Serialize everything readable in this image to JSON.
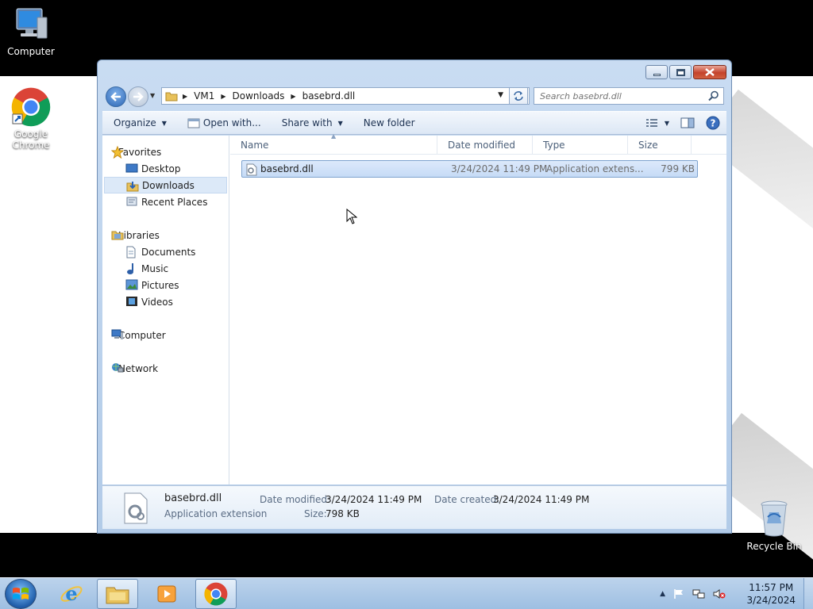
{
  "desktop": {
    "icons": [
      {
        "label": "Computer"
      },
      {
        "label": "Google Chrome"
      },
      {
        "label": "Recycle Bin"
      }
    ]
  },
  "window": {
    "address": {
      "segments": [
        "VM1",
        "Downloads",
        "basebrd.dll"
      ]
    },
    "search": {
      "placeholder": "Search basebrd.dll"
    },
    "toolbar": {
      "organize": "Organize",
      "open_with": "Open with...",
      "share_with": "Share with",
      "new_folder": "New folder"
    },
    "nav": {
      "favorites": "Favorites",
      "desktop": "Desktop",
      "downloads": "Downloads",
      "recent_places": "Recent Places",
      "libraries": "Libraries",
      "documents": "Documents",
      "music": "Music",
      "pictures": "Pictures",
      "videos": "Videos",
      "computer": "Computer",
      "network": "Network"
    },
    "columns": {
      "name": "Name",
      "date_modified": "Date modified",
      "type": "Type",
      "size": "Size"
    },
    "files": [
      {
        "name": "basebrd.dll",
        "date_modified": "3/24/2024 11:49 PM",
        "type": "Application extens...",
        "size": "799 KB"
      }
    ],
    "details": {
      "name": "basebrd.dll",
      "kind": "Application extension",
      "date_modified_label": "Date modified:",
      "date_modified": "3/24/2024 11:49 PM",
      "date_created_label": "Date created:",
      "date_created": "3/24/2024 11:49 PM",
      "size_label": "Size:",
      "size": "798 KB"
    }
  },
  "taskbar": {
    "time": "11:57 PM",
    "date": "3/24/2024"
  },
  "colors": {
    "accent": "#3a6aa5",
    "selection": "#c6dbf6",
    "taskbar": "#9ebfe2"
  }
}
